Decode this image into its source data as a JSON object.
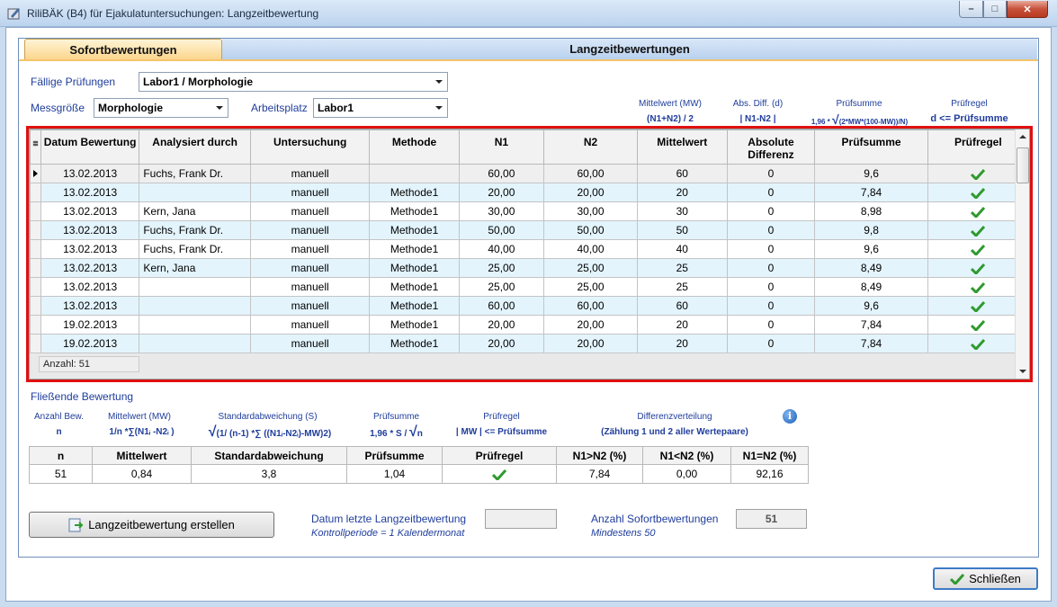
{
  "window": {
    "title": "RiliBÄK (B4) für Ejakulatuntersuchungen: Langzeitbewertung",
    "min_glyph": "–",
    "max_glyph": "□",
    "close_glyph": "✕"
  },
  "tabs": [
    {
      "label": "Sofortbewertungen",
      "active": true
    },
    {
      "label": "Langzeitbewertungen",
      "active": false
    }
  ],
  "filters": {
    "faellige_label": "Fällige Prüfungen",
    "faellige_value": "Labor1 / Morphologie",
    "messgroesse_label": "Messgröße",
    "messgroesse_value": "Morphologie",
    "arbeitsplatz_label": "Arbeitsplatz",
    "arbeitsplatz_value": "Labor1"
  },
  "formula_hints": {
    "mw_title": "Mittelwert (MW)",
    "mw_formula": "(N1+N2) / 2",
    "diff_title": "Abs. Diff. (d)",
    "diff_formula": "| N1-N2 |",
    "sum_title": "Prüfsumme",
    "sum_formula_prefix": "1,96 * ",
    "sum_formula_root": "(2*MW*(100-MW))/N)",
    "regel_title": "Prüfregel",
    "regel_formula": "d <= Prüfsumme"
  },
  "grid": {
    "columns": [
      "Datum Bewertung",
      "Analysiert durch",
      "Untersuchung",
      "Methode",
      "N1",
      "N2",
      "Mittelwert",
      "Absolute Differenz",
      "Prüfsumme",
      "Prüfregel"
    ],
    "rows": [
      {
        "datum": "13.02.2013",
        "analyst": "Fuchs, Frank Dr.",
        "untersuchung": "manuell",
        "methode": "",
        "n1": "60,00",
        "n2": "60,00",
        "mw": "60",
        "diff": "0",
        "sum": "9,6",
        "ok": true
      },
      {
        "datum": "13.02.2013",
        "analyst": "",
        "untersuchung": "manuell",
        "methode": "Methode1",
        "n1": "20,00",
        "n2": "20,00",
        "mw": "20",
        "diff": "0",
        "sum": "7,84",
        "ok": true
      },
      {
        "datum": "13.02.2013",
        "analyst": "Kern, Jana",
        "untersuchung": "manuell",
        "methode": "Methode1",
        "n1": "30,00",
        "n2": "30,00",
        "mw": "30",
        "diff": "0",
        "sum": "8,98",
        "ok": true
      },
      {
        "datum": "13.02.2013",
        "analyst": "Fuchs, Frank Dr.",
        "untersuchung": "manuell",
        "methode": "Methode1",
        "n1": "50,00",
        "n2": "50,00",
        "mw": "50",
        "diff": "0",
        "sum": "9,8",
        "ok": true
      },
      {
        "datum": "13.02.2013",
        "analyst": "Fuchs, Frank Dr.",
        "untersuchung": "manuell",
        "methode": "Methode1",
        "n1": "40,00",
        "n2": "40,00",
        "mw": "40",
        "diff": "0",
        "sum": "9,6",
        "ok": true
      },
      {
        "datum": "13.02.2013",
        "analyst": "Kern, Jana",
        "untersuchung": "manuell",
        "methode": "Methode1",
        "n1": "25,00",
        "n2": "25,00",
        "mw": "25",
        "diff": "0",
        "sum": "8,49",
        "ok": true
      },
      {
        "datum": "13.02.2013",
        "analyst": "",
        "untersuchung": "manuell",
        "methode": "Methode1",
        "n1": "25,00",
        "n2": "25,00",
        "mw": "25",
        "diff": "0",
        "sum": "8,49",
        "ok": true
      },
      {
        "datum": "13.02.2013",
        "analyst": "",
        "untersuchung": "manuell",
        "methode": "Methode1",
        "n1": "60,00",
        "n2": "60,00",
        "mw": "60",
        "diff": "0",
        "sum": "9,6",
        "ok": true
      },
      {
        "datum": "19.02.2013",
        "analyst": "",
        "untersuchung": "manuell",
        "methode": "Methode1",
        "n1": "20,00",
        "n2": "20,00",
        "mw": "20",
        "diff": "0",
        "sum": "7,84",
        "ok": true
      },
      {
        "datum": "19.02.2013",
        "analyst": "",
        "untersuchung": "manuell",
        "methode": "Methode1",
        "n1": "20,00",
        "n2": "20,00",
        "mw": "20",
        "diff": "0",
        "sum": "7,84",
        "ok": true
      }
    ],
    "count_label": "Anzahl: 51"
  },
  "fliessend": {
    "heading": "Fließende Bewertung",
    "anzahl_title": "Anzahl Bew.",
    "anzahl_formula": "n",
    "mw_title": "Mittelwert (MW)",
    "mw_formula": "1/n *∑(N1ᵢ -N2ᵢ )",
    "sd_title": "Standardabweichung (S)",
    "sd_formula": "(1/ (n-1) *∑ ((N1ᵢ-N2ᵢ)-MW)2)",
    "sum_title": "Prüfsumme",
    "sum_formula": "1,96 * S / ",
    "sum_formula_root": "n",
    "regel_title": "Prüfregel",
    "regel_formula": "| MW |  <= Prüfsumme",
    "verteilung_title": "Differenzverteilung",
    "verteilung_formula": "(Zählung 1 und 2 aller Wertepaare)",
    "info_glyph": "i",
    "root_glyph": "√",
    "columns": [
      "n",
      "Mittelwert",
      "Standardabweichung",
      "Prüfsumme",
      "Prüfregel",
      "N1>N2 (%)",
      "N1<N2 (%)",
      "N1=N2 (%)"
    ],
    "row": {
      "n": "51",
      "mw": "0,84",
      "sd": "3,8",
      "sum": "1,04",
      "ok": true,
      "gt": "7,84",
      "lt": "0,00",
      "eq": "92,16"
    }
  },
  "footer": {
    "create_button": "Langzeitbewertung erstellen",
    "datum_label": "Datum letzte Langzeitbewertung",
    "datum_sub": "Kontrollperiode = 1 Kalendermonat",
    "datum_value": "",
    "anzahl_label": "Anzahl Sofortbewertungen",
    "anzahl_sub": "Mindestens 50",
    "anzahl_value": "51",
    "close_button": "Schließen"
  },
  "colors": {
    "accent_label": "#1f3d9c",
    "highlight_frame": "#e01010",
    "check": "#2e9a2e",
    "alt_row": "#e3f4fd"
  }
}
